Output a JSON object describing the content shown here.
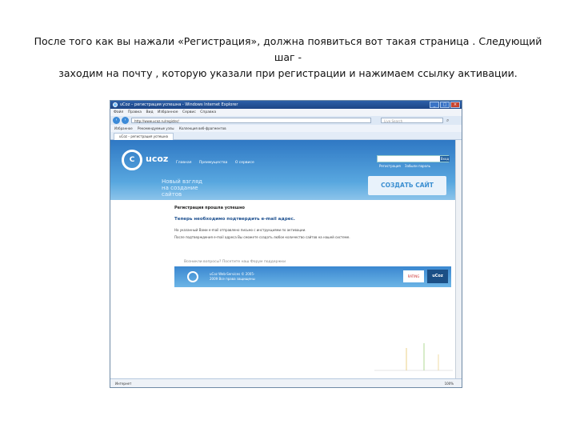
{
  "caption": {
    "line1": "После того как вы нажали «Регистрация», должна появиться вот такая страница . Следующий шаг -",
    "line2": "заходим на почту , которую указали при регистрации и нажимаем ссылку активации."
  },
  "browser": {
    "title": "uCoz – регистрация успешна - Windows Internet Explorer",
    "window_buttons": [
      "_",
      "□",
      "×"
    ],
    "menu": [
      "Файл",
      "Правка",
      "Вид",
      "Избранное",
      "Сервис",
      "Справка"
    ],
    "nav_back": "‹",
    "nav_forward": "›",
    "address": "http://www.ucoz.ru/register/",
    "search_placeholder": "Live Search",
    "favorites": [
      "Избранное",
      "Рекомендуемые узлы",
      "Коллекция веб-фрагментов"
    ],
    "tab": "uCoz – регистрация успешна",
    "status": "Интернет",
    "zoom": "100%"
  },
  "site": {
    "logo": "C",
    "logo_text": "ucoz",
    "nav": [
      "Главная",
      "Преимущества",
      "О сервисе"
    ],
    "login_button": "Вход",
    "reg_links": [
      "Регистрация",
      "Забыли пароль"
    ],
    "tagline": "Новый взгляд на создание сайтов",
    "create_button": "СОЗДАТЬ САЙТ",
    "success_title": "Регистрация прошла успешно",
    "next_step": "Теперь необходимо подтвердить e-mail адрес.",
    "info1": "На указанный Вами e-mail отправлено письмо с инструкциями по активации.",
    "info2": "После подтверждения e-mail адреса Вы сможете создать любое количество сайтов на нашей системе.",
    "notice": "Возникли вопросы? Посетите наш Форум поддержки",
    "footer_text": "uCoz Web-Services © 2005-2009 Все права защищены",
    "badge1": "RATING",
    "badge2": "uCoz"
  },
  "colors": {
    "header_blue": "#2f78c4",
    "accent": "#3b8fd1"
  }
}
